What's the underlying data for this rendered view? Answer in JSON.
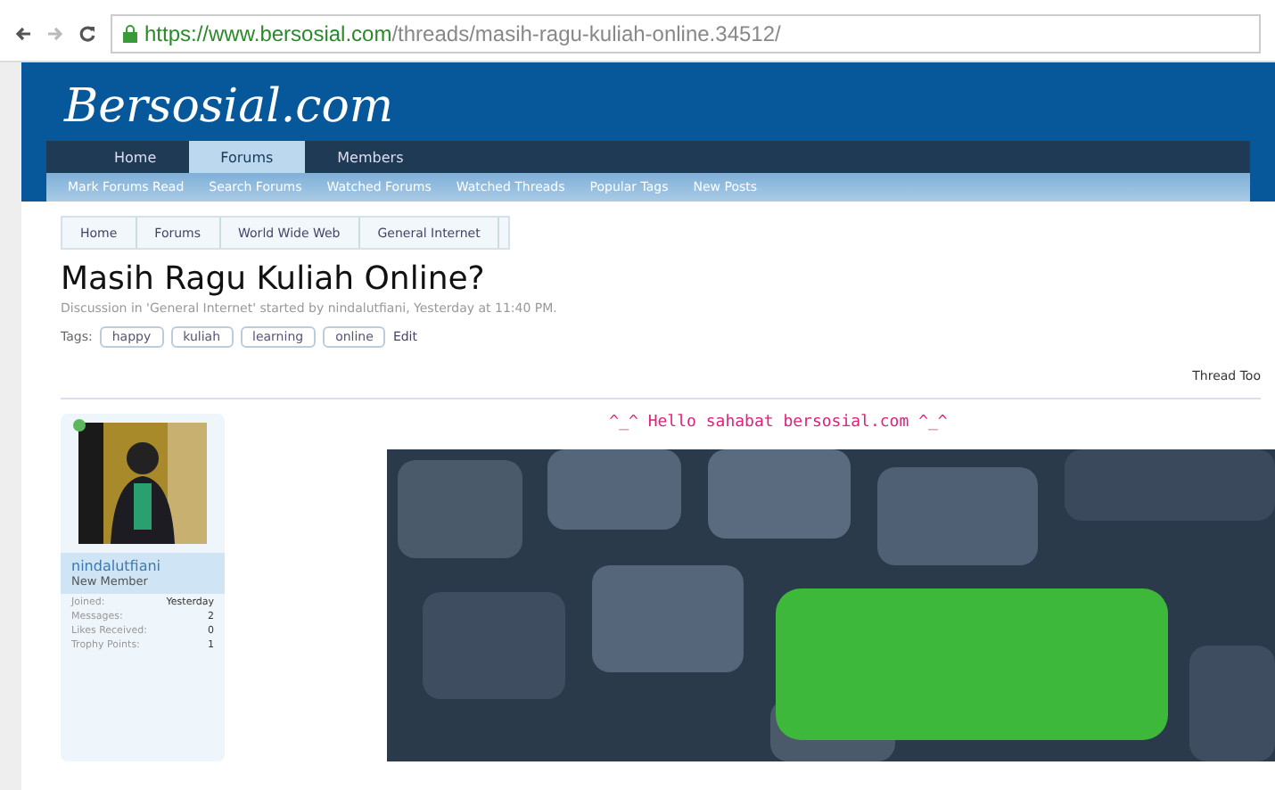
{
  "browser": {
    "url_host": "https://www.bersosial.com",
    "url_path": "/threads/masih-ragu-kuliah-online.34512/"
  },
  "site": {
    "logo": "Bersosial.com"
  },
  "nav_tabs": [
    {
      "label": "Home",
      "selected": false
    },
    {
      "label": "Forums",
      "selected": true
    },
    {
      "label": "Members",
      "selected": false
    }
  ],
  "sub_nav": [
    "Mark Forums Read",
    "Search Forums",
    "Watched Forums",
    "Watched Threads",
    "Popular Tags",
    "New Posts"
  ],
  "breadcrumbs": [
    "Home",
    "Forums",
    "World Wide Web",
    "General Internet"
  ],
  "thread": {
    "title": "Masih Ragu Kuliah Online?",
    "meta": "Discussion in 'General Internet' started by nindalutfiani, Yesterday at 11:40 PM.",
    "tags_label": "Tags:",
    "tags": [
      "happy",
      "kuliah",
      "learning",
      "online"
    ],
    "edit": "Edit",
    "tools": "Thread Too"
  },
  "user": {
    "name": "nindalutfiani",
    "title": "New Member",
    "online": true,
    "stats": [
      {
        "label": "Joined:",
        "value": "Yesterday"
      },
      {
        "label": "Messages:",
        "value": "2"
      },
      {
        "label": "Likes Received:",
        "value": "0"
      },
      {
        "label": "Trophy Points:",
        "value": "1"
      }
    ]
  },
  "post": {
    "greeting": "^_^ Hello sahabat bersosial.com ^_^"
  }
}
